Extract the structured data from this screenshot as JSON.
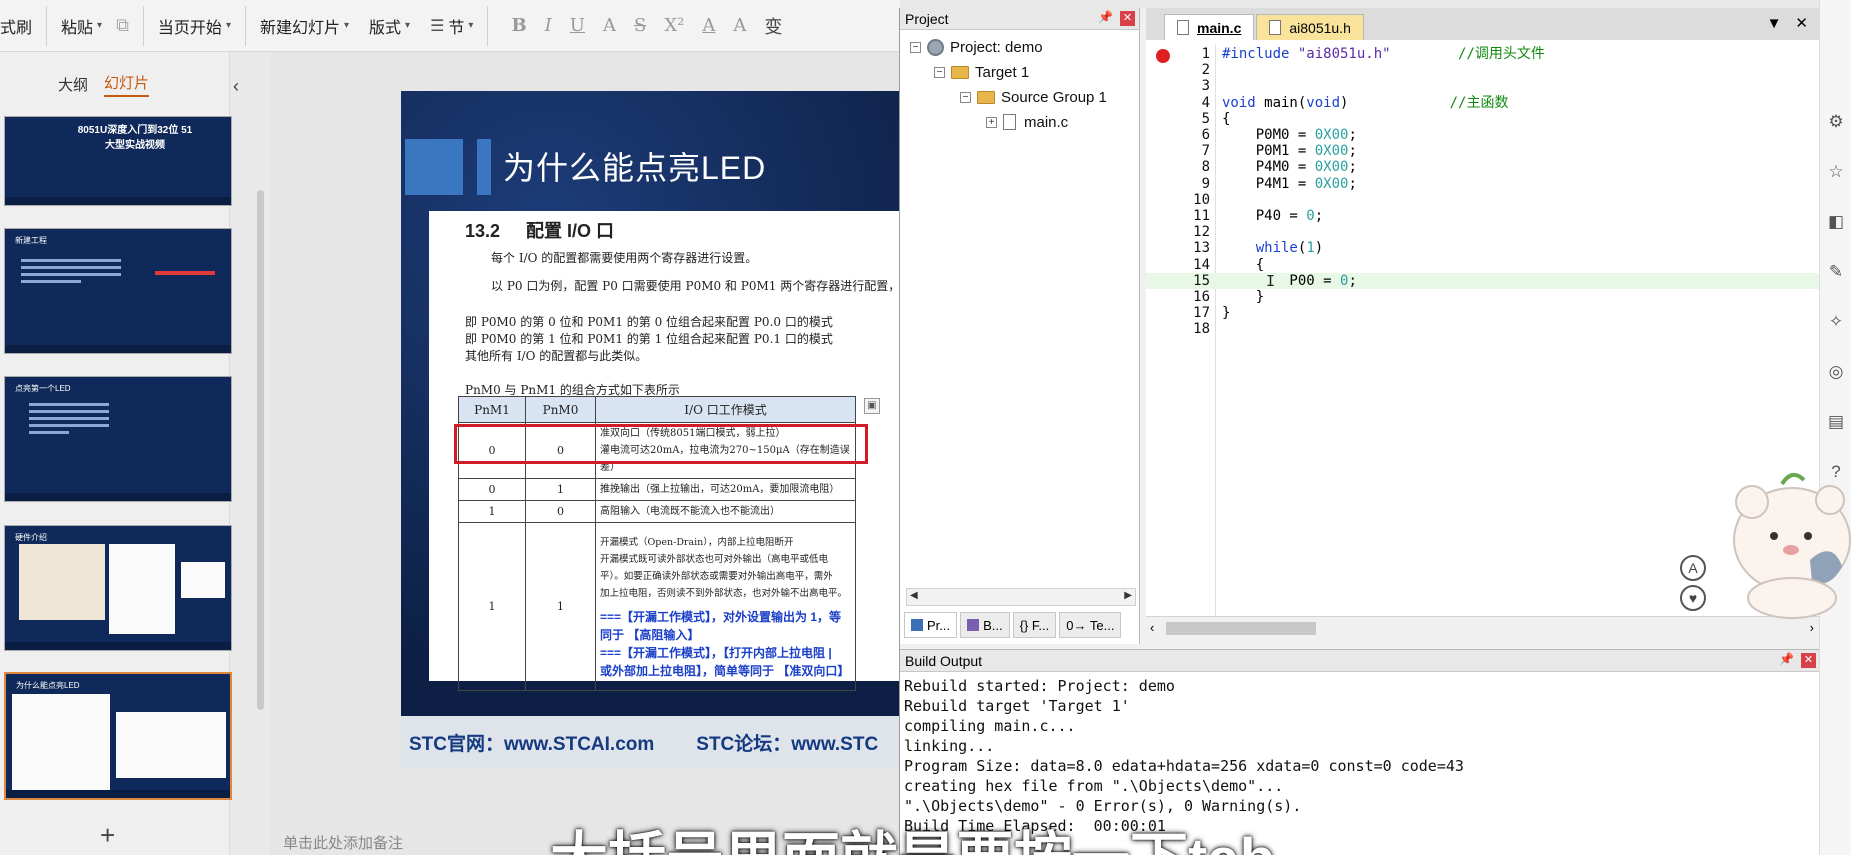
{
  "ppt": {
    "toolbar": {
      "format_painter": "式刷",
      "paste": "粘贴",
      "start_from_current": "当页开始",
      "new_slide": "新建幻灯片",
      "layout": "版式",
      "section": "节",
      "format_buttons": [
        "B",
        "I",
        "U",
        "A",
        "S",
        "X²",
        "A",
        "A",
        "变"
      ]
    },
    "sidebar": {
      "tabs": [
        {
          "label": "大纲"
        },
        {
          "label": "幻灯片"
        }
      ],
      "thumbnails": [
        {
          "title": "8051U深度入门到32位 51大型实战视频"
        },
        {
          "title": "新建工程"
        },
        {
          "title": "点亮第一个LED"
        },
        {
          "title": "硬件介绍"
        },
        {
          "title": "为什么能点亮LED"
        }
      ],
      "add_slide": "+",
      "notes_placeholder": "单击此处添加备注"
    },
    "slide": {
      "title": "为什么能点亮LED",
      "doc": {
        "section_no": "13.2",
        "section_title": "配置 I/O 口",
        "p1": "每个 I/O 的配置都需要使用两个寄存器进行设置。",
        "p2": "以 P0 口为例，配置 P0 口需要使用 P0M0 和 P0M1 两个寄存器进行配置，如下图所",
        "p3": "即 P0M0 的第 0 位和 P0M1 的第 0 位组合起来配置 P0.0 口的模式",
        "p4": "即 P0M0 的第 1 位和 P0M1 的第 1 位组合起来配置 P0.1 口的模式",
        "p5": "其他所有 I/O 的配置都与此类似。",
        "table_caption": "PnM0 与 PnM1 的组合方式如下表所示",
        "table": {
          "headers": [
            "PnM1",
            "PnM0",
            "I/O 口工作模式"
          ],
          "rows": [
            {
              "m1": "0",
              "m0": "0",
              "mode": [
                "准双向口（传统8051端口模式，弱上拉）",
                "灌电流可达20mA，拉电流为270~150μA（存在制造误差）"
              ]
            },
            {
              "m1": "0",
              "m0": "1",
              "mode": [
                "推挽输出（强上拉输出，可达20mA，要加限流电阻）"
              ]
            },
            {
              "m1": "1",
              "m0": "0",
              "mode": [
                "高阻输入（电流既不能流入也不能流出）"
              ]
            },
            {
              "m1": "1",
              "m0": "1",
              "mode": [
                "开漏模式（Open-Drain），内部上拉电阻断开",
                "开漏模式既可读外部状态也可对外输出（高电平或低电",
                "平）。如要正确读外部状态或需要对外输出高电平，需外",
                "加上拉电阻，否则读不到外部状态，也对外输不出高电平。"
              ],
              "notes": [
                "===【开漏工作模式】，对外设置输出为 1，等",
                "同于 【高阻输入】",
                "===【开漏工作模式】，【打开内部上拉电阻 |",
                "或外部加上拉电阻】，简单等同于 【准双向口】"
              ]
            }
          ]
        }
      },
      "footer_left": "STC官网：www.STCAI.com",
      "footer_right": "STC论坛：www.STC"
    }
  },
  "keil": {
    "project_panel": {
      "title": "Project",
      "tree": {
        "project": "Project: demo",
        "target": "Target 1",
        "group": "Source Group 1",
        "file": "main.c"
      },
      "tabs": [
        "Pr...",
        "B...",
        "{} F...",
        "0→ Te..."
      ]
    },
    "editor": {
      "tabs": [
        {
          "label": "main.c"
        },
        {
          "label": "ai8051u.h"
        }
      ],
      "lines": [
        {
          "n": "1",
          "seg": [
            {
              "c": "kw",
              "t": "#include "
            },
            {
              "c": "str",
              "t": "\"ai8051u.h\""
            },
            {
              "c": "",
              "t": "        "
            },
            {
              "c": "cm",
              "t": "//调用头文件"
            }
          ]
        },
        {
          "n": "2",
          "seg": []
        },
        {
          "n": "3",
          "seg": []
        },
        {
          "n": "4",
          "seg": [
            {
              "c": "kw",
              "t": "void"
            },
            {
              "c": "",
              "t": " main("
            },
            {
              "c": "kw",
              "t": "void"
            },
            {
              "c": "",
              "t": ")            "
            },
            {
              "c": "cm",
              "t": "//主函数"
            }
          ]
        },
        {
          "n": "5",
          "seg": [
            {
              "c": "",
              "t": "{"
            }
          ]
        },
        {
          "n": "6",
          "seg": [
            {
              "c": "",
              "t": "    P0M0 = "
            },
            {
              "c": "num",
              "t": "0X00"
            },
            {
              "c": "",
              "t": ";"
            }
          ]
        },
        {
          "n": "7",
          "seg": [
            {
              "c": "",
              "t": "    P0M1 = "
            },
            {
              "c": "num",
              "t": "0X00"
            },
            {
              "c": "",
              "t": ";"
            }
          ]
        },
        {
          "n": "8",
          "seg": [
            {
              "c": "",
              "t": "    P4M0 = "
            },
            {
              "c": "num",
              "t": "0X00"
            },
            {
              "c": "",
              "t": ";"
            }
          ]
        },
        {
          "n": "9",
          "seg": [
            {
              "c": "",
              "t": "    P4M1 = "
            },
            {
              "c": "num",
              "t": "0X00"
            },
            {
              "c": "",
              "t": ";"
            }
          ]
        },
        {
          "n": "10",
          "seg": []
        },
        {
          "n": "11",
          "seg": [
            {
              "c": "",
              "t": "    P40 = "
            },
            {
              "c": "num",
              "t": "0"
            },
            {
              "c": "",
              "t": ";"
            }
          ]
        },
        {
          "n": "12",
          "seg": []
        },
        {
          "n": "13",
          "seg": [
            {
              "c": "",
              "t": "    "
            },
            {
              "c": "kw",
              "t": "while"
            },
            {
              "c": "",
              "t": "("
            },
            {
              "c": "num",
              "t": "1"
            },
            {
              "c": "",
              "t": ")"
            }
          ]
        },
        {
          "n": "14",
          "seg": [
            {
              "c": "",
              "t": "    {"
            }
          ]
        },
        {
          "n": "15",
          "seg": [
            {
              "c": "",
              "t": "        P00 = "
            },
            {
              "c": "num",
              "t": "0"
            },
            {
              "c": "",
              "t": ";"
            }
          ]
        },
        {
          "n": "16",
          "seg": [
            {
              "c": "",
              "t": "    }"
            }
          ]
        },
        {
          "n": "17",
          "seg": [
            {
              "c": "",
              "t": "}"
            }
          ]
        },
        {
          "n": "18",
          "seg": []
        }
      ]
    },
    "build_output": {
      "title": "Build Output",
      "lines": [
        "Rebuild started: Project: demo",
        "Rebuild target 'Target 1'",
        "compiling main.c...",
        "linking...",
        "Program Size: data=8.0 edata+hdata=256 xdata=0 const=0 code=43",
        "creating hex file from \".\\Objects\\demo\"...",
        "\".\\Objects\\demo\" - 0 Error(s), 0 Warning(s).",
        "Build Time Elapsed:  00:00:01"
      ]
    }
  },
  "subtitle": "大括号里面就是要按一下tab"
}
